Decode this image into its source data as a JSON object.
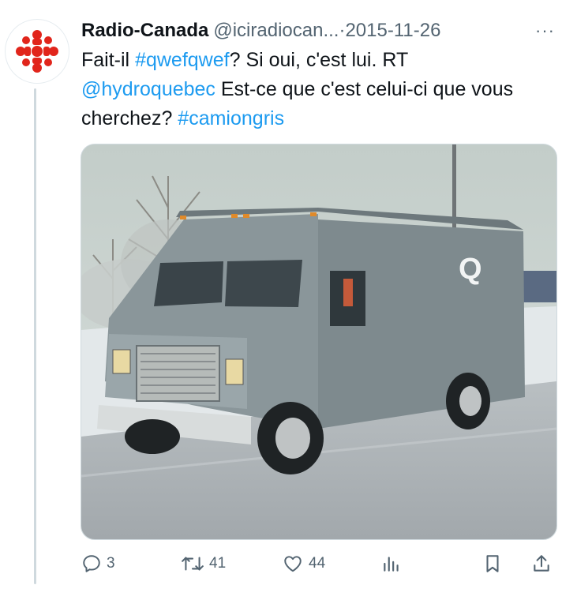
{
  "tweet": {
    "author_name": "Radio-Canada",
    "handle": "@iciradiocan...",
    "separator": "·",
    "date": "2015-11-26",
    "more_label": "···",
    "text": {
      "part1": "Fait-il ",
      "hashtag1": "#qwefqwef",
      "part2": "? Si oui, c'est lui. RT ",
      "mention": "@hydroquebec",
      "part3": " Est-ce que c'est celui-ci que vous cherchez? ",
      "hashtag2": "#camiongris"
    },
    "media": {
      "truck_logo_letter": "Q"
    }
  },
  "actions": {
    "replies": "3",
    "retweets": "41",
    "likes": "44"
  },
  "colors": {
    "link": "#1d9bf0",
    "muted": "#536471",
    "brand_red": "#e1251b"
  },
  "icons": [
    "radio-canada-logo-icon",
    "more-icon",
    "reply-icon",
    "retweet-icon",
    "like-icon",
    "views-icon",
    "bookmark-icon",
    "share-icon"
  ]
}
